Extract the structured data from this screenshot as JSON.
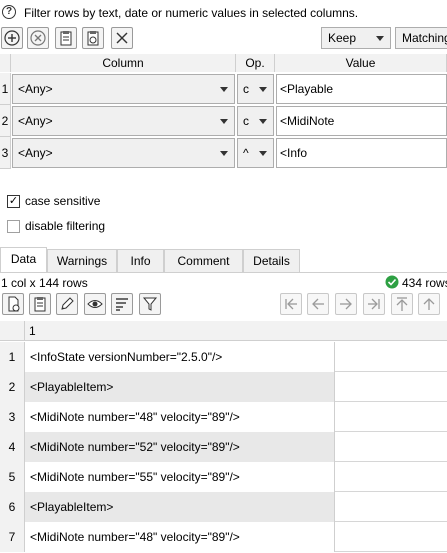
{
  "help": {
    "text": "Filter rows by text, date or numeric values in selected columns."
  },
  "toolbar": {
    "keep_value": "Keep",
    "matching_value": "Matching"
  },
  "filter_grid": {
    "headers": {
      "column": "Column",
      "op": "Op.",
      "value": "Value"
    },
    "rows": [
      {
        "num": "1",
        "column": "<Any>",
        "op": "c",
        "value": "<Playable"
      },
      {
        "num": "2",
        "column": "<Any>",
        "op": "c",
        "value": "<MidiNote"
      },
      {
        "num": "3",
        "column": "<Any>",
        "op": "^",
        "value": "<Info"
      }
    ]
  },
  "options": {
    "case_sensitive": {
      "label": "case sensitive",
      "checked": true,
      "mark": "✓"
    },
    "disable_filtering": {
      "label": "disable filtering",
      "checked": false
    }
  },
  "tabs": [
    "Data",
    "Warnings",
    "Info",
    "Comment",
    "Details"
  ],
  "status": {
    "dims": "1 col x 144 rows",
    "count": "434 rows"
  },
  "table": {
    "column_header": "1",
    "rows": [
      {
        "num": "1",
        "value": "<InfoState versionNumber=\"2.5.0\"/>"
      },
      {
        "num": "2",
        "value": "<PlayableItem>"
      },
      {
        "num": "3",
        "value": "<MidiNote number=\"48\" velocity=\"89\"/>"
      },
      {
        "num": "4",
        "value": "<MidiNote number=\"52\" velocity=\"89\"/>"
      },
      {
        "num": "5",
        "value": "<MidiNote number=\"55\" velocity=\"89\"/>"
      },
      {
        "num": "6",
        "value": "<PlayableItem>"
      },
      {
        "num": "7",
        "value": "<MidiNote number=\"48\" velocity=\"89\"/>"
      }
    ]
  },
  "colors": {
    "status_ok": "#2ea043",
    "row_alt": "#e8e8e8"
  }
}
